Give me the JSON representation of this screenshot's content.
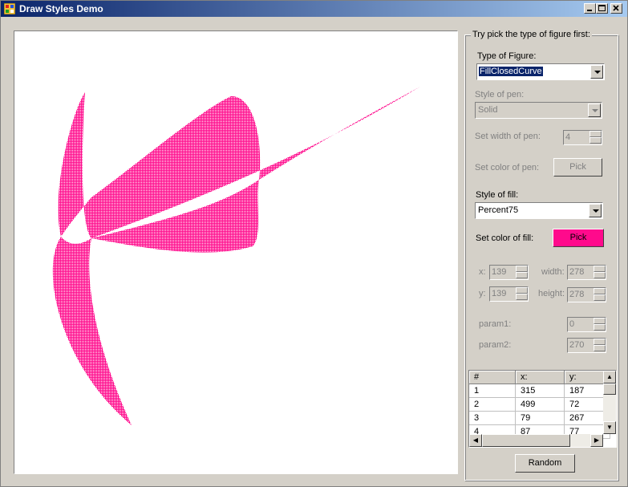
{
  "window": {
    "title": "Draw Styles Demo"
  },
  "panel": {
    "group_caption": "Try pick the type of figure first:",
    "type_of_figure_label": "Type of Figure:",
    "type_of_figure_value": "FillClosedCurve",
    "style_of_pen_label": "Style of pen:",
    "style_of_pen_value": "Solid",
    "width_of_pen_label": "Set width of pen:",
    "width_of_pen_value": "4",
    "color_of_pen_label": "Set color of pen:",
    "pick_pen_label": "Pick",
    "style_of_fill_label": "Style of fill:",
    "style_of_fill_value": "Percent75",
    "color_of_fill_label": "Set color of fill:",
    "pick_fill_label": "Pick",
    "fill_color": "#ff0a8c",
    "x_label": "x:",
    "x_value": "139",
    "y_label": "y:",
    "y_value": "139",
    "width_label": "width:",
    "width_value": "278",
    "height_label": "height:",
    "height_value": "278",
    "param1_label": "param1:",
    "param1_value": "0",
    "param2_label": "param2:",
    "param2_value": "270",
    "random_label": "Random"
  },
  "points_grid": {
    "headers": [
      "#",
      "x:",
      "y:"
    ],
    "rows": [
      [
        "1",
        "315",
        "187"
      ],
      [
        "2",
        "499",
        "72"
      ],
      [
        "3",
        "79",
        "267"
      ],
      [
        "4",
        "87",
        "77"
      ]
    ]
  },
  "icons": {
    "app": "app-icon",
    "minimize": "minimize-icon",
    "maximize": "maximize-icon",
    "close": "close-icon"
  },
  "colors": {
    "title_bar_start": "#0a246a",
    "title_bar_end": "#a6caf0",
    "fill_color": "#ff0a8c",
    "selection": "#0a246a"
  }
}
